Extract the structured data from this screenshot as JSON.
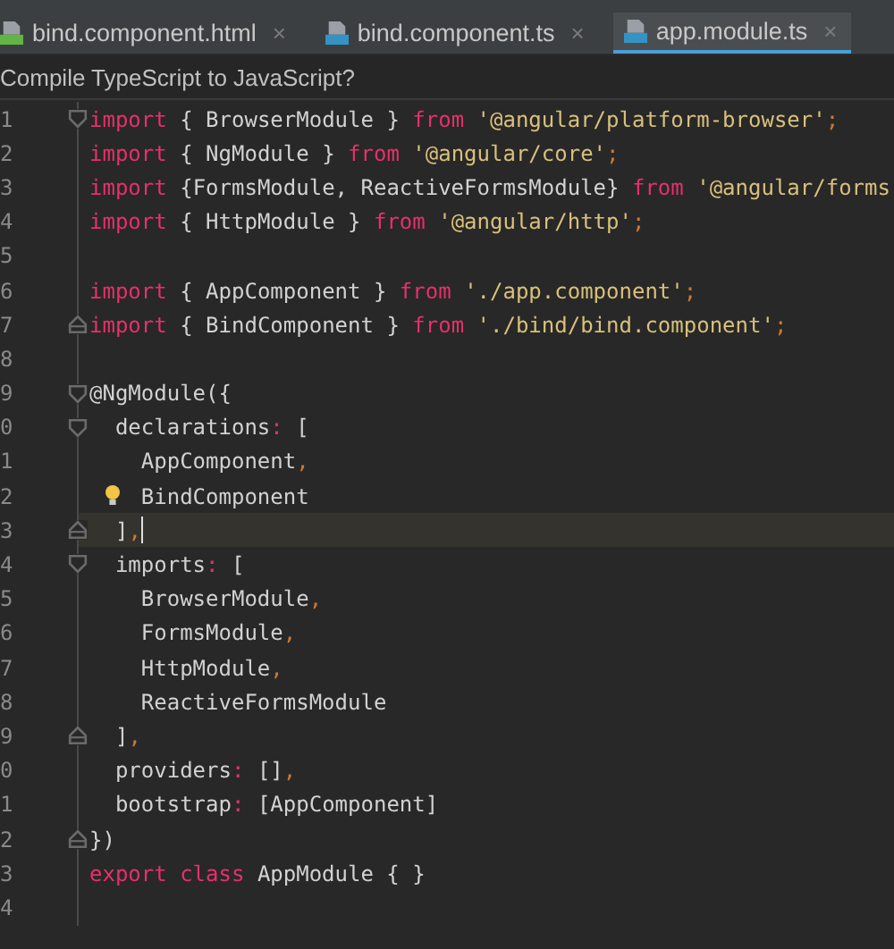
{
  "tabs": [
    {
      "kind": "html",
      "label": "bind.component.html",
      "close": "×",
      "selected": false
    },
    {
      "kind": "ts",
      "label": "bind.component.ts",
      "close": "×",
      "selected": false
    },
    {
      "kind": "ts",
      "label": "app.module.ts",
      "close": "×",
      "selected": true
    }
  ],
  "notification": "Compile TypeScript to JavaScript?",
  "editor": {
    "lines": [
      {
        "number": "1",
        "kind": "fold_start",
        "current": false,
        "bulb": false,
        "tokens": [
          {
            "kind": "k",
            "text": "import"
          },
          {
            "kind": "p",
            "text": " { BrowserModule } "
          },
          {
            "kind": "k",
            "text": "from"
          },
          {
            "kind": "s",
            "text": " '@angular/platform-browser'"
          },
          {
            "kind": "o",
            "text": ";"
          }
        ]
      },
      {
        "number": "2",
        "kind": "plain",
        "current": false,
        "bulb": false,
        "tokens": [
          {
            "kind": "k",
            "text": "import"
          },
          {
            "kind": "p",
            "text": " { NgModule } "
          },
          {
            "kind": "k",
            "text": "from"
          },
          {
            "kind": "s",
            "text": " '@angular/core'"
          },
          {
            "kind": "o",
            "text": ";"
          }
        ]
      },
      {
        "number": "3",
        "kind": "plain",
        "current": false,
        "bulb": false,
        "tokens": [
          {
            "kind": "k",
            "text": "import"
          },
          {
            "kind": "p",
            "text": " {FormsModule, ReactiveFormsModule} "
          },
          {
            "kind": "k",
            "text": "from"
          },
          {
            "kind": "s",
            "text": " '@angular/forms"
          }
        ]
      },
      {
        "number": "4",
        "kind": "plain",
        "current": false,
        "bulb": false,
        "tokens": [
          {
            "kind": "k",
            "text": "import"
          },
          {
            "kind": "p",
            "text": " { HttpModule } "
          },
          {
            "kind": "k",
            "text": "from"
          },
          {
            "kind": "s",
            "text": " '@angular/http'"
          },
          {
            "kind": "o",
            "text": ";"
          }
        ]
      },
      {
        "number": "5",
        "kind": "plain",
        "current": false,
        "bulb": false
      },
      {
        "number": "6",
        "kind": "plain",
        "current": false,
        "bulb": false,
        "tokens": [
          {
            "kind": "k",
            "text": "import"
          },
          {
            "kind": "p",
            "text": " { AppComponent } "
          },
          {
            "kind": "k",
            "text": "from"
          },
          {
            "kind": "s",
            "text": " './app.component'"
          },
          {
            "kind": "o",
            "text": ";"
          }
        ]
      },
      {
        "number": "7",
        "kind": "fold_end",
        "current": false,
        "bulb": false,
        "tokens": [
          {
            "kind": "k",
            "text": "import"
          },
          {
            "kind": "p",
            "text": " { BindComponent } "
          },
          {
            "kind": "k",
            "text": "from"
          },
          {
            "kind": "s",
            "text": " './bind/bind.component'"
          },
          {
            "kind": "o",
            "text": ";"
          }
        ]
      },
      {
        "number": "8",
        "kind": "plain",
        "current": false,
        "bulb": false
      },
      {
        "number": "9",
        "kind": "fold_start",
        "current": false,
        "bulb": false,
        "tokens": [
          {
            "kind": "p",
            "text": "@NgModule({"
          }
        ]
      },
      {
        "number": "0",
        "kind": "fold_start",
        "current": false,
        "bulb": false,
        "tokens": [
          {
            "kind": "p",
            "text": "  declarations"
          },
          {
            "kind": "m",
            "text": ":"
          },
          {
            "kind": "p",
            "text": " ["
          }
        ]
      },
      {
        "number": "1",
        "kind": "plain",
        "current": false,
        "bulb": false,
        "tokens": [
          {
            "kind": "p",
            "text": "    AppComponent"
          },
          {
            "kind": "o",
            "text": ","
          }
        ]
      },
      {
        "number": "2",
        "kind": "plain",
        "current": false,
        "bulb": true,
        "tokens": [
          {
            "kind": "p",
            "text": "    BindComponent"
          }
        ]
      },
      {
        "number": "3",
        "kind": "fold_end",
        "current": true,
        "bulb": false,
        "tokens": [
          {
            "kind": "p",
            "text": "  ]"
          },
          {
            "kind": "o",
            "text": ","
          }
        ]
      },
      {
        "number": "4",
        "kind": "fold_start",
        "current": false,
        "bulb": false,
        "tokens": [
          {
            "kind": "p",
            "text": "  imports"
          },
          {
            "kind": "m",
            "text": ":"
          },
          {
            "kind": "p",
            "text": " ["
          }
        ]
      },
      {
        "number": "5",
        "kind": "plain",
        "current": false,
        "bulb": false,
        "tokens": [
          {
            "kind": "p",
            "text": "    BrowserModule"
          },
          {
            "kind": "o",
            "text": ","
          }
        ]
      },
      {
        "number": "6",
        "kind": "plain",
        "current": false,
        "bulb": false,
        "tokens": [
          {
            "kind": "p",
            "text": "    FormsModule"
          },
          {
            "kind": "o",
            "text": ","
          }
        ]
      },
      {
        "number": "7",
        "kind": "plain",
        "current": false,
        "bulb": false,
        "tokens": [
          {
            "kind": "p",
            "text": "    HttpModule"
          },
          {
            "kind": "o",
            "text": ","
          }
        ]
      },
      {
        "number": "8",
        "kind": "plain",
        "current": false,
        "bulb": false,
        "tokens": [
          {
            "kind": "p",
            "text": "    ReactiveFormsModule"
          }
        ]
      },
      {
        "number": "9",
        "kind": "fold_end",
        "current": false,
        "bulb": false,
        "tokens": [
          {
            "kind": "p",
            "text": "  ]"
          },
          {
            "kind": "o",
            "text": ","
          }
        ]
      },
      {
        "number": "0",
        "kind": "plain",
        "current": false,
        "bulb": false,
        "tokens": [
          {
            "kind": "p",
            "text": "  providers"
          },
          {
            "kind": "m",
            "text": ":"
          },
          {
            "kind": "p",
            "text": " []"
          },
          {
            "kind": "o",
            "text": ","
          }
        ]
      },
      {
        "number": "1",
        "kind": "plain",
        "current": false,
        "bulb": false,
        "tokens": [
          {
            "kind": "p",
            "text": "  bootstrap"
          },
          {
            "kind": "m",
            "text": ":"
          },
          {
            "kind": "p",
            "text": " [AppComponent]"
          }
        ]
      },
      {
        "number": "2",
        "kind": "fold_end",
        "current": false,
        "bulb": false,
        "tokens": [
          {
            "kind": "p",
            "text": "})"
          }
        ]
      },
      {
        "number": "3",
        "kind": "plain",
        "current": false,
        "bulb": false,
        "tokens": [
          {
            "kind": "k",
            "text": "export class"
          },
          {
            "kind": "p",
            "text": " AppModule { }"
          }
        ]
      },
      {
        "number": "4",
        "kind": "plain",
        "current": false,
        "bulb": false
      }
    ]
  }
}
